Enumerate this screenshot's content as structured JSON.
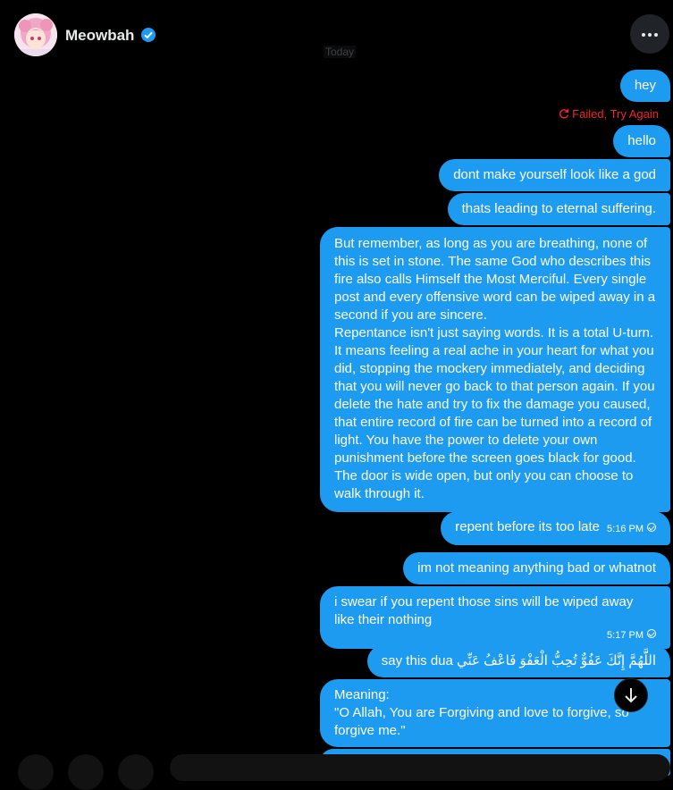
{
  "header": {
    "name": "Meowbah",
    "verified_icon": "verified-badge-icon",
    "more_icon": "more-horizontal-icon"
  },
  "divider": {
    "today": "Today"
  },
  "messages": [
    {
      "text": "hey"
    },
    {
      "status": "Failed, Try Again",
      "status_icon": "retry-icon"
    },
    {
      "text": "hello"
    },
    {
      "text": "dont make yourself look like a god"
    },
    {
      "text": "thats leading to eternal suffering."
    },
    {
      "paragraphs": [
        "But remember, as long as you are breathing, none of this is set in stone. The same God who describes this fire also calls Himself the Most Merciful. Every single post and every offensive word can be wiped away in a second if you are sincere.",
        "Repentance isn't just saying words. It is a total U-turn. It means feeling a real ache in your heart for what you did, stopping the mockery immediately, and deciding that you will never go back to that person again. If you delete the hate and try to fix the damage you caused, that entire record of fire can be turned into a record of light. You have the power to delete your own punishment before the screen goes black for good. The door is wide open, but only you can choose to walk through it."
      ]
    },
    {
      "text": "repent before its too late",
      "time": "5:16 PM"
    },
    {
      "text": "im not meaning anything bad or whatnot"
    },
    {
      "text": "i swear if you repent those sins will be wiped away like their nothing",
      "time": "5:17 PM"
    },
    {
      "text": "say this dua اللَّهُمَّ إِنَّكَ عَفُوٌّ تُحِبُّ الْعَفْوَ فَاعْفُ عَنِّي"
    },
    {
      "lines": [
        "Meaning:",
        "\"O Allah, You are Forgiving and love to forgive, so forgive me.\""
      ]
    }
  ],
  "scroll_icon": "arrow-down-icon",
  "colors": {
    "bubble": "#1d9bf0",
    "background": "#000000",
    "error": "#f4212e"
  }
}
